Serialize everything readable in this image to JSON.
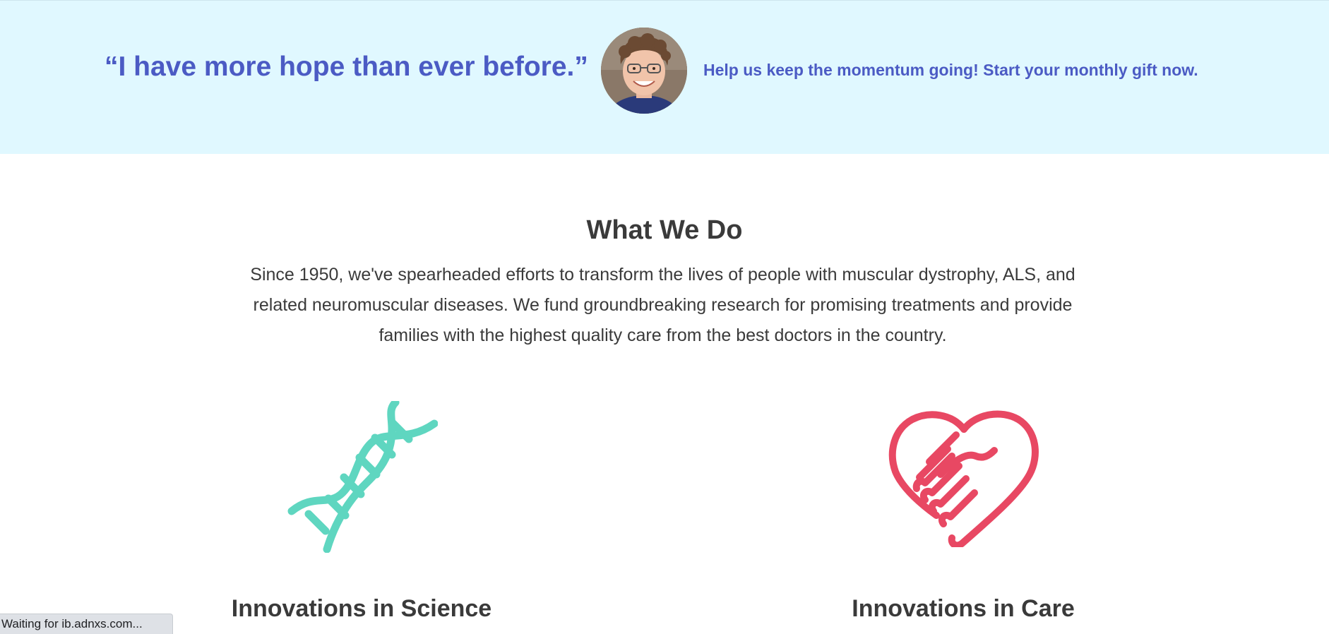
{
  "banner": {
    "quote": "“I have more hope than ever before.”",
    "cta": "Help us keep the momentum going! Start your monthly gift now.",
    "background_color": "#e0f8ff",
    "text_color": "#4b5bc4"
  },
  "what_we_do": {
    "title": "What We Do",
    "body": "Since 1950, we've spearheaded efforts to transform the lives of people with muscular dystrophy, ALS, and related neuromuscular diseases. We fund groundbreaking research for promising treatments and provide families with the highest quality care from the best doctors in the country."
  },
  "features": [
    {
      "title": "Innovations in Science",
      "icon": "dna-icon",
      "color": "#5fd6c0"
    },
    {
      "title": "Innovations in Care",
      "icon": "heart-handshake-icon",
      "color": "#e84863"
    }
  ],
  "status_bar": {
    "text": "Waiting for ib.adnxs.com..."
  }
}
